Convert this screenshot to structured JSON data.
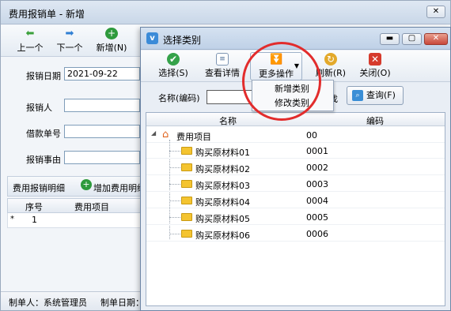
{
  "main_window": {
    "title": "费用报销单 - 新增",
    "toolbar": {
      "prev": "上一个",
      "next": "下一个",
      "add": "新增(N)"
    },
    "form": {
      "date_label": "报销日期",
      "date_value": "2021-09-22",
      "person_label": "报销人",
      "loan_label": "借款单号",
      "reason_label": "报销事由"
    },
    "details": {
      "tab": "费用报销明细",
      "add_button": "增加费用明细"
    },
    "grid": {
      "col_no": "序号",
      "col_item": "费用项目",
      "row_marker": "*",
      "row_no": "1"
    },
    "status": {
      "creator": "制单人：系统管理员",
      "created_date": "制单日期："
    }
  },
  "dialog": {
    "title": "选择类别",
    "toolbar": {
      "select": "选择(S)",
      "view": "查看详情",
      "more": "更多操作",
      "refresh": "刷新(R)",
      "close": "关闭(O)"
    },
    "more_menu": [
      "新增类别",
      "修改类别"
    ],
    "search": {
      "label": "名称(编码)",
      "extra_text": "找",
      "query_button": "查询(F)"
    },
    "tree": {
      "col_name": "名称",
      "col_code": "编码",
      "root": {
        "name": "费用项目",
        "code": "00"
      },
      "children": [
        {
          "name": "购买原材料01",
          "code": "0001"
        },
        {
          "name": "购买原材料02",
          "code": "0002"
        },
        {
          "name": "购买原材料03",
          "code": "0003"
        },
        {
          "name": "购买原材料04",
          "code": "0004"
        },
        {
          "name": "购买原材料05",
          "code": "0005"
        },
        {
          "name": "购买原材料06",
          "code": "0006"
        }
      ]
    }
  }
}
